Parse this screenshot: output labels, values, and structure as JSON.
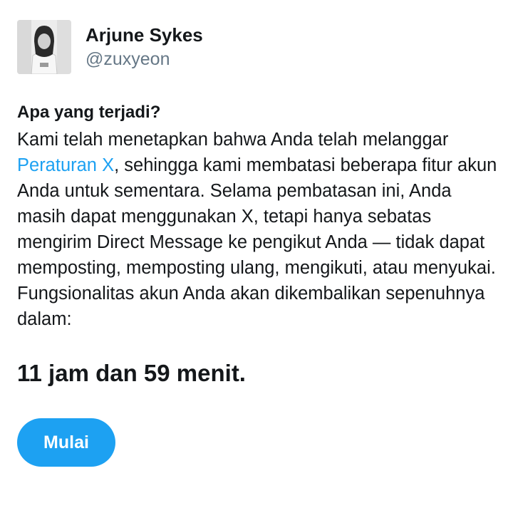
{
  "profile": {
    "display_name": "Arjune Sykes",
    "handle": "@zuxyeon"
  },
  "notice": {
    "heading": "Apa yang terjadi?",
    "body_before_link": "Kami telah menetapkan bahwa Anda telah melanggar ",
    "rules_link": "Peraturan X",
    "body_after_link": ", sehingga kami membatasi beberapa fitur akun Anda untuk sementara. Selama pembatasan ini, Anda masih dapat menggunakan X, tetapi hanya sebatas mengirim Direct Message ke pengikut Anda — tidak dapat memposting, memposting ulang, mengikuti, atau menyukai. Fungsionalitas akun Anda akan dikembalikan sepenuhnya dalam:",
    "countdown": "11 jam dan 59 menit."
  },
  "actions": {
    "start_label": "Mulai"
  },
  "colors": {
    "accent": "#1da1f2",
    "text": "#14171a",
    "muted": "#657786"
  }
}
